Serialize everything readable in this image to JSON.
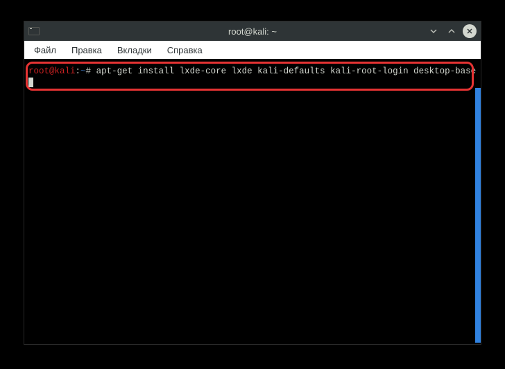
{
  "window": {
    "title": "root@kali: ~"
  },
  "menu": {
    "file": "Файл",
    "edit": "Правка",
    "tabs": "Вкладки",
    "help": "Справка"
  },
  "terminal": {
    "prompt_user": "root@kali",
    "prompt_separator": ":",
    "prompt_path": "~",
    "prompt_symbol": "#",
    "command": "apt-get install lxde-core lxde kali-defaults kali-root-login desktop-base"
  }
}
